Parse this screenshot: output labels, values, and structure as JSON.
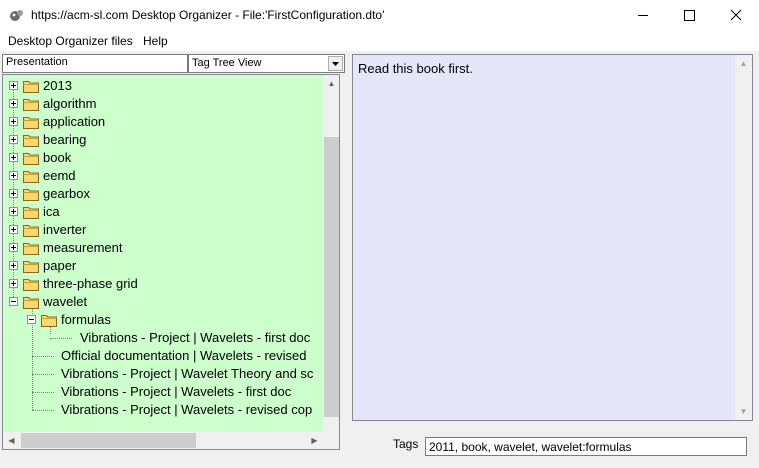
{
  "window": {
    "title": "https://acm-sl.com Desktop Organizer - File:'FirstConfiguration.dto'",
    "minimize_glyph": "—",
    "maximize_glyph": "☐",
    "close_glyph": "✕"
  },
  "menu": {
    "items": [
      {
        "label": "Desktop Organizer files"
      },
      {
        "label": "Help"
      }
    ]
  },
  "toolbar": {
    "presentation_label": "Presentation",
    "view_mode_selected": "Tag Tree View"
  },
  "tree": {
    "nodes": [
      {
        "label": "2013",
        "icon": "folder-icon",
        "expand": "plus"
      },
      {
        "label": "algorithm",
        "icon": "folder-icon",
        "expand": "plus"
      },
      {
        "label": "application",
        "icon": "folder-icon",
        "expand": "plus"
      },
      {
        "label": "bearing",
        "icon": "folder-icon",
        "expand": "plus"
      },
      {
        "label": "book",
        "icon": "folder-icon",
        "expand": "plus"
      },
      {
        "label": "eemd",
        "icon": "folder-icon",
        "expand": "plus"
      },
      {
        "label": "gearbox",
        "icon": "folder-icon",
        "expand": "plus"
      },
      {
        "label": "ica",
        "icon": "folder-icon",
        "expand": "plus"
      },
      {
        "label": "inverter",
        "icon": "folder-icon",
        "expand": "plus"
      },
      {
        "label": "measurement",
        "icon": "folder-icon",
        "expand": "plus"
      },
      {
        "label": "paper",
        "icon": "folder-icon",
        "expand": "plus"
      },
      {
        "label": "three-phase grid",
        "icon": "folder-icon",
        "expand": "plus"
      },
      {
        "label": "wavelet",
        "icon": "folder-icon",
        "expand": "minus"
      },
      {
        "label": "formulas",
        "icon": "folder-icon",
        "expand": "minus"
      },
      {
        "label": "Vibrations - Project | Wavelets - first doc",
        "icon": "none",
        "expand": "none"
      },
      {
        "label": "Official documentation | Wavelets - revised",
        "icon": "none",
        "expand": "none"
      },
      {
        "label": "Vibrations - Project | Wavelet Theory and sc",
        "icon": "none",
        "expand": "none"
      },
      {
        "label": "Vibrations - Project | Wavelets - first doc",
        "icon": "none",
        "expand": "none"
      },
      {
        "label": "Vibrations - Project | Wavelets - revised cop",
        "icon": "none",
        "expand": "none"
      }
    ]
  },
  "notes": {
    "text": "Read this book first."
  },
  "tags": {
    "label": "Tags",
    "value": "2011, book, wavelet, wavelet:formulas"
  },
  "colors": {
    "tree_background": "#ccffcc",
    "notes_background": "#e6e6fa",
    "folder_fill": "#f8d775"
  }
}
